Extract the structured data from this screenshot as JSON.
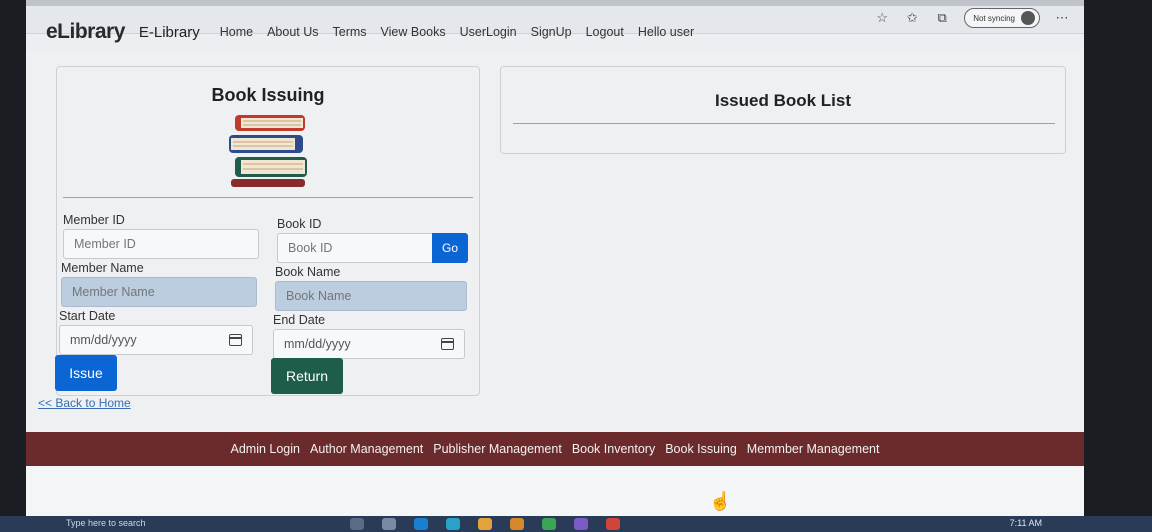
{
  "browser": {
    "sync_label": "Not syncing",
    "icons": [
      "favorite-icon",
      "favorites-list-icon",
      "collections-icon",
      "more-icon"
    ]
  },
  "navbar": {
    "logo": "eLibrary",
    "brand": "E-Library",
    "links": [
      "Home",
      "About Us",
      "Terms",
      "View Books",
      "UserLogin",
      "SignUp",
      "Logout",
      "Hello user"
    ]
  },
  "issuing": {
    "title": "Book Issuing",
    "member_id_label": "Member ID",
    "member_id_placeholder": "Member ID",
    "book_id_label": "Book ID",
    "book_id_placeholder": "Book ID",
    "go_label": "Go",
    "member_name_label": "Member Name",
    "member_name_placeholder": "Member Name",
    "book_name_label": "Book Name",
    "book_name_placeholder": "Book Name",
    "start_date_label": "Start Date",
    "end_date_label": "End Date",
    "date_placeholder": "mm/dd/yyyy",
    "issue_label": "Issue",
    "return_label": "Return",
    "back_link": "<< Back to Home"
  },
  "issued_list": {
    "title": "Issued Book List"
  },
  "footer": {
    "links": [
      "Admin Login",
      "Author Management",
      "Publisher Management",
      "Book Inventory",
      "Book Issuing",
      "Memmber Management"
    ]
  },
  "taskbar": {
    "search_text": "Type here to search",
    "time": "7:11 AM"
  },
  "colors": {
    "primary": "#0b66d4",
    "return": "#1e5d4b",
    "footer": "#6b2a2c",
    "readonly": "#bccde0"
  }
}
